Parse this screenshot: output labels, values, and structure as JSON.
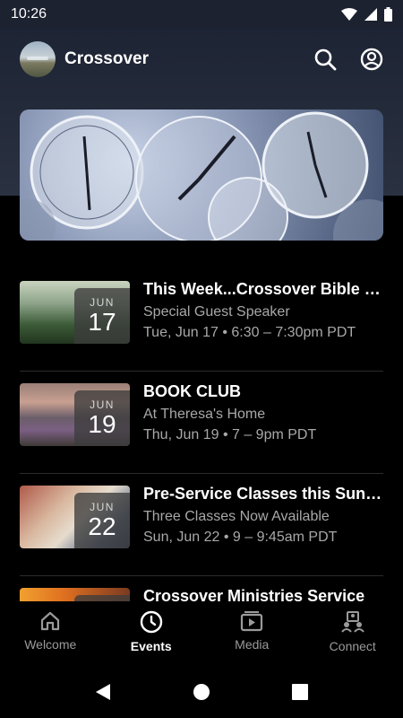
{
  "status_bar": {
    "time": "10:26",
    "icons": [
      "wifi-icon",
      "signal-icon",
      "battery-icon"
    ]
  },
  "app_bar": {
    "title": "Crossover",
    "actions": [
      "search-icon",
      "account-icon"
    ]
  },
  "banner": {
    "image": "clock-collage-banner"
  },
  "events": [
    {
      "month": "JUN",
      "day": "17",
      "title": "This Week...Crossover Bible Study",
      "subtitle": "Special Guest Speaker",
      "when": "Tue, Jun 17 • 6:30 – 7:30pm PDT"
    },
    {
      "month": "JUN",
      "day": "19",
      "title": "BOOK CLUB",
      "subtitle": "At Theresa's Home",
      "when": "Thu, Jun 19 • 7 – 9pm PDT"
    },
    {
      "month": "JUN",
      "day": "22",
      "title": "Pre-Service Classes this Sunday",
      "subtitle": "Three Classes Now Available",
      "when": "Sun, Jun 22 • 9 – 9:45am PDT"
    },
    {
      "month": "",
      "day": "",
      "title": "Crossover Ministries Service",
      "subtitle": "",
      "when": ""
    }
  ],
  "bottom_nav": [
    {
      "label": "Welcome",
      "icon": "home-icon",
      "active": false
    },
    {
      "label": "Events",
      "icon": "clock-icon",
      "active": true
    },
    {
      "label": "Media",
      "icon": "media-icon",
      "active": false
    },
    {
      "label": "Connect",
      "icon": "connect-icon",
      "active": false
    }
  ],
  "colors": {
    "background": "#000000",
    "header": "#1d2434",
    "muted_text": "#a8a8a8"
  }
}
